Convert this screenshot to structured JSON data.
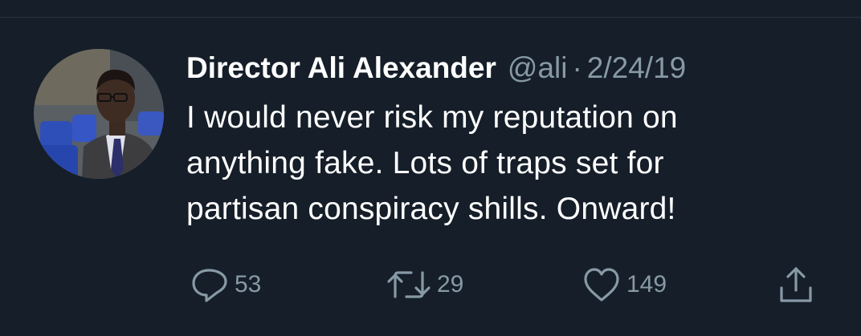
{
  "tweet": {
    "display_name": "Director Ali Alexander",
    "handle": "@ali",
    "separator": "·",
    "date": "2/24/19",
    "text_lines": [
      "I would never risk my reputation on",
      "anything fake. Lots of traps set for",
      "partisan conspiracy shills. Onward!"
    ],
    "actions": {
      "replies": "53",
      "retweets": "29",
      "likes": "149"
    }
  },
  "icons": {
    "reply": "reply-icon",
    "retweet": "retweet-icon",
    "like": "heart-icon",
    "share": "share-icon"
  },
  "colors": {
    "background": "#151e29",
    "text": "#ffffff",
    "secondary": "#8899a6"
  }
}
